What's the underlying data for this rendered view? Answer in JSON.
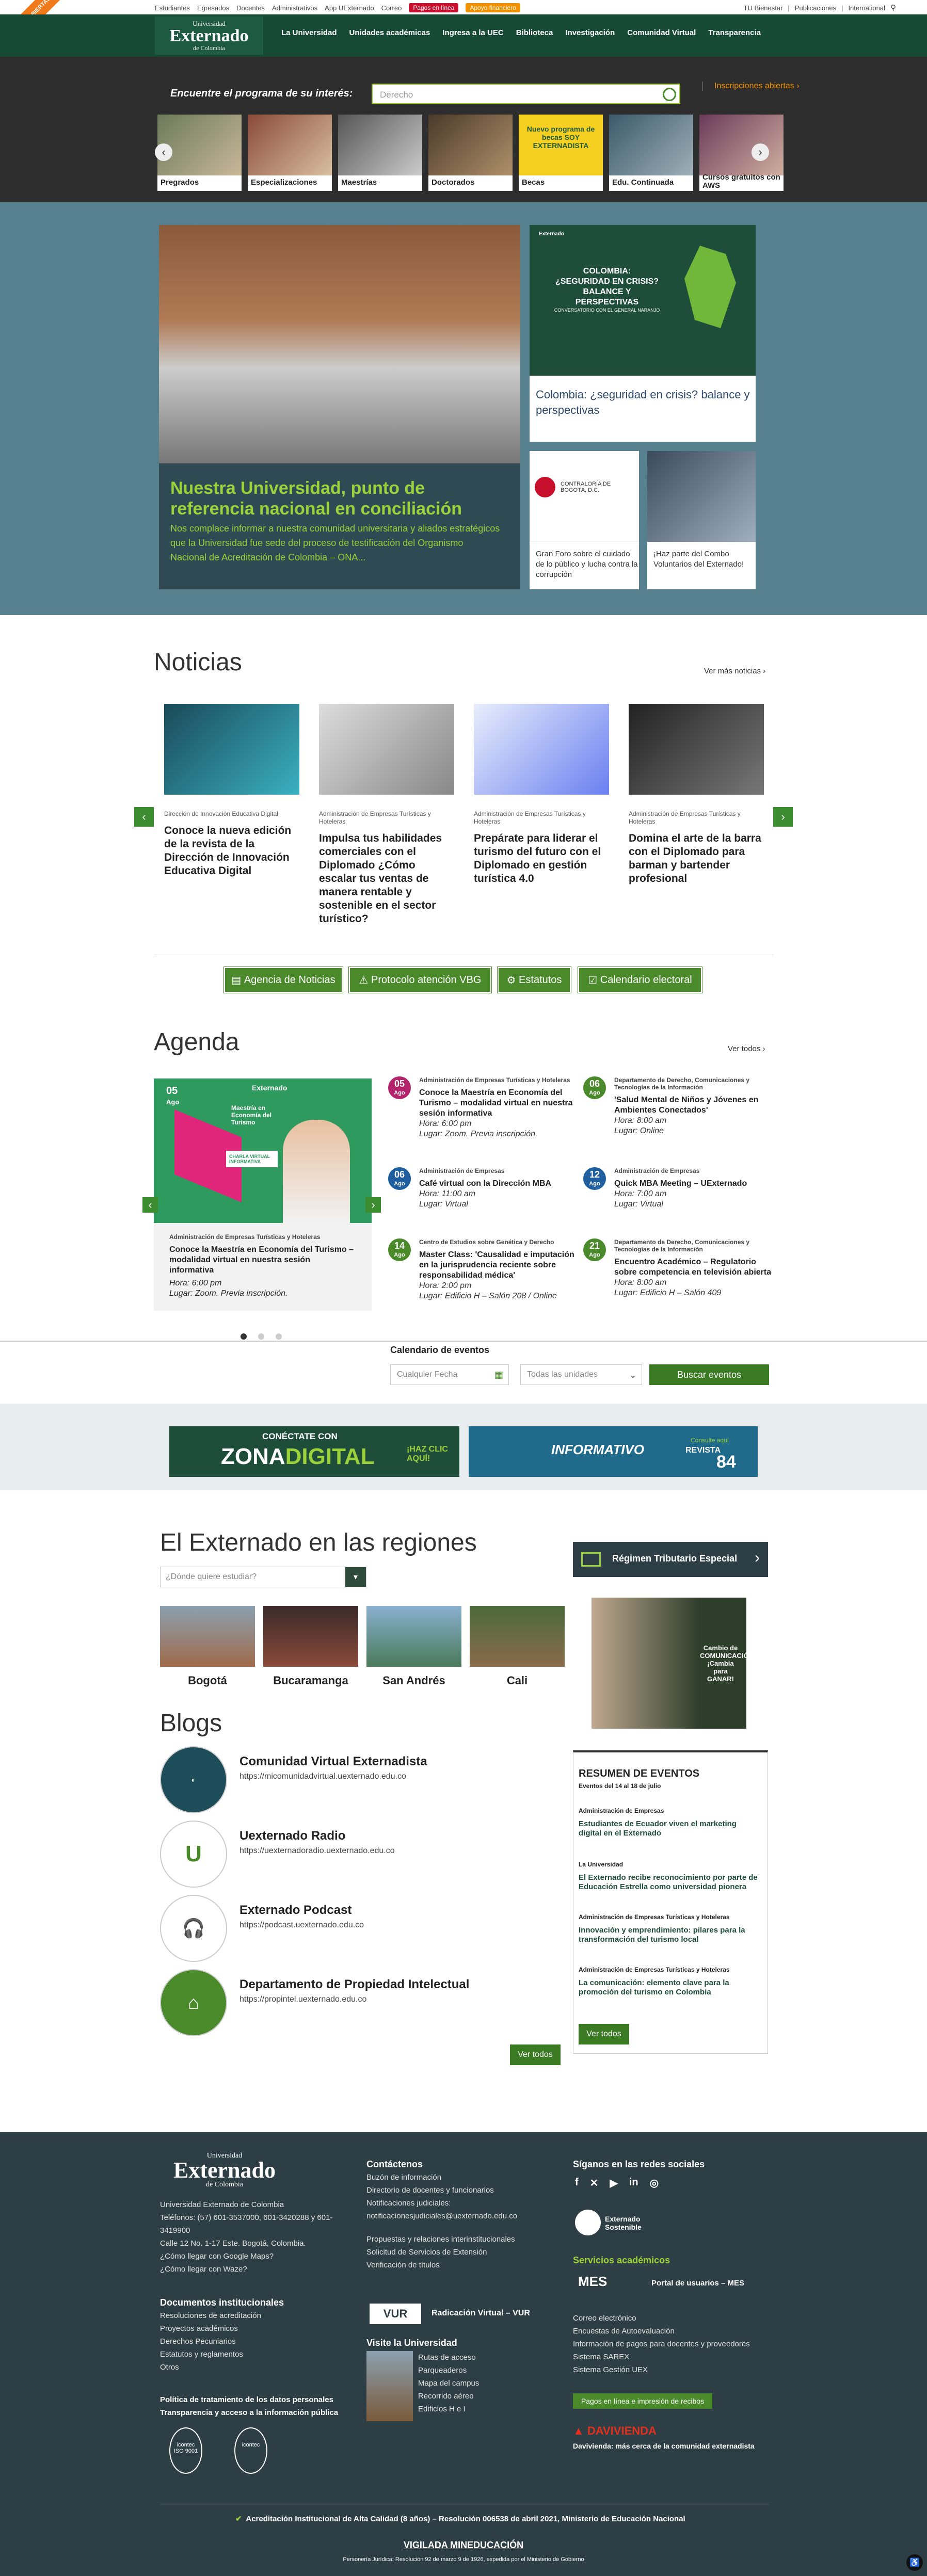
{
  "topbar": {
    "links": [
      "Estudiantes",
      "Egresados",
      "Docentes",
      "Administrativos",
      "App UExternado",
      "Correo"
    ],
    "pay": "Pagos en línea",
    "aid": "Apoyo financiero",
    "right": [
      "TU Bienestar",
      "Publicaciones",
      "International"
    ],
    "ribbon": "INSCRIPCIONES ABIERTAS"
  },
  "logo": {
    "top": "Universidad",
    "main": "Externado",
    "bottom": "de Colombia"
  },
  "menu": [
    "La Universidad",
    "Unidades académicas",
    "Ingresa a la UEC",
    "Biblioteca",
    "Investigación",
    "Comunidad Virtual",
    "Transparencia"
  ],
  "finder": {
    "title": "Encuentre el programa de su interés:",
    "placeholder": "Derecho",
    "inscr": "Inscripciones abiertas",
    "cards": [
      "Pregrados",
      "Especializaciones",
      "Maestrías",
      "Doctorados",
      "Becas",
      "Edu. Continuada",
      "Cursos gratuitos con AWS"
    ],
    "becas_img": "Nuevo programa de becas SOY EXTERNADISTA"
  },
  "hero": {
    "title": "Nuestra Universidad, punto de referencia nacional en conciliación",
    "text": "Nos complace informar a nuestra comunidad universitaria y aliados estratégicos que la Universidad fue sede del proceso de testificación del Organismo Nacional de Acreditación de Colombia – ONA...",
    "side1": "Colombia: ¿seguridad en crisis? balance y perspectivas",
    "side1_img": "COLOMBIA: ¿SEGURIDAD EN CRISIS? BALANCE Y PERSPECTIVAS",
    "side1_sub": "CONVERSATORIO CON EL GENERAL NARANJO",
    "side2": "Gran Foro sobre el cuidado de lo público y lucha contra la corrupción",
    "side2_img": "CONTRALORÍA DE BOGOTÁ, D.C.",
    "side3": "¡Haz parte del Combo Voluntarios del Externado!"
  },
  "news": {
    "title": "Noticias",
    "more": "Ver más noticias",
    "items": [
      {
        "cat": "Dirección de Innovación Educativa Digital",
        "title": "Conoce la nueva edición de la revista de la Dirección de Innovación Educativa Digital"
      },
      {
        "cat": "Administración de Empresas Turísticas y Hoteleras",
        "title": "Impulsa tus habilidades comerciales con el Diplomado ¿Cómo escalar tus ventas de manera rentable y sostenible en el sector turístico?"
      },
      {
        "cat": "Administración de Empresas Turísticas y Hoteleras",
        "title": "Prepárate para liderar el turismo del futuro con el Diplomado en gestión turística 4.0"
      },
      {
        "cat": "Administración de Empresas Turísticas y Hoteleras",
        "title": "Domina el arte de la barra con el Diplomado para barman y bartender profesional"
      }
    ],
    "buttons": [
      "Agencia de Noticias",
      "Protocolo atención VBG",
      "Estatutos",
      "Calendario electoral"
    ]
  },
  "agenda": {
    "title": "Agenda",
    "more": "Ver todos",
    "featured": {
      "day": "05",
      "month": "Ago",
      "cat": "Administración de Empresas Turísticas y Hoteleras",
      "title": "Conoce la Maestría en Economía del Turismo – modalidad virtual en nuestra sesión informativa",
      "hora": "Hora: 6:00 pm",
      "lugar": "Lugar: Zoom. Previa inscripción.",
      "img_title": "Maestría en Economía del Turismo",
      "img_badge": "CHARLA VIRTUAL INFORMATIVA"
    },
    "events": [
      {
        "day": "05",
        "month": "Ago",
        "color": "#b3246c",
        "cat": "Administración de Empresas Turísticas y Hoteleras",
        "title": "Conoce la Maestría en Economía del Turismo – modalidad virtual en nuestra sesión informativa",
        "hora": "Hora: 6:00 pm",
        "lugar": "Lugar: Zoom. Previa inscripción."
      },
      {
        "day": "06",
        "month": "Ago",
        "color": "#4a8a2a",
        "cat": "Departamento de Derecho, Comunicaciones y Tecnologías de la Información",
        "title": "'Salud Mental de Niños y Jóvenes en Ambientes Conectados'",
        "hora": "Hora: 8:00 am",
        "lugar": "Lugar: Online"
      },
      {
        "day": "06",
        "month": "Ago",
        "color": "#1f5fa0",
        "cat": "Administración de Empresas",
        "title": "Café virtual con la Dirección MBA",
        "hora": "Hora: 11:00 am",
        "lugar": "Lugar: Virtual"
      },
      {
        "day": "12",
        "month": "Ago",
        "color": "#1f5fa0",
        "cat": "Administración de Empresas",
        "title": "Quick MBA Meeting – UExternado",
        "hora": "Hora: 7:00 am",
        "lugar": "Lugar: Virtual"
      },
      {
        "day": "14",
        "month": "Ago",
        "color": "#4a8a2a",
        "cat": "Centro de Estudios sobre Genética y Derecho",
        "title": "Master Class: 'Causalidad e imputación en la jurisprudencia reciente sobre responsabilidad médica'",
        "hora": "Hora: 2:00 pm",
        "lugar": "Lugar: Edificio H – Salón 208 / Online"
      },
      {
        "day": "21",
        "month": "Ago",
        "color": "#4a8a2a",
        "cat": "Departamento de Derecho, Comunicaciones y Tecnologías de la Información",
        "title": "Encuentro Académico – Regulatorio sobre competencia en televisión abierta",
        "hora": "Hora: 8:00 am",
        "lugar": "Lugar: Edificio H – Salón 409"
      }
    ]
  },
  "calendar": {
    "title": "Calendario de eventos",
    "date_placeholder": "Cualquier Fecha",
    "units": "Todas las unidades",
    "button": "Buscar eventos"
  },
  "banners": {
    "b1a": "CONÉCTATE CON",
    "b1b": "ZONA",
    "b1c": "DIGITAL",
    "b1d": "¡HAZ CLIC AQUÍ!",
    "b2a": "INFORMATIVO",
    "b2b": "Consulte aquí",
    "b2c": "REVISTA",
    "b2d": "84"
  },
  "regions": {
    "title": "El Externado en las regiones",
    "placeholder": "¿Dónde quiere estudiar?",
    "items": [
      "Bogotá",
      "Bucaramanga",
      "San Andrés",
      "Cali"
    ],
    "regimen": "Régimen Tributario Especial",
    "side_img": "Cambio de COMUNICACIÓN ¡Cambia para GANAR!"
  },
  "blogs": {
    "title": "Blogs",
    "items": [
      {
        "name": "Comunidad Virtual Externadista",
        "url": "https://micomunidadvirtual.uexternado.edu.co"
      },
      {
        "name": "Uexternado Radio",
        "url": "https://uexternadoradio.uexternado.edu.co"
      },
      {
        "name": "Externado Podcast",
        "url": "https://podcast.uexternado.edu.co"
      },
      {
        "name": "Departamento de Propiedad Intelectual",
        "url": "https://propintel.uexternado.edu.co"
      }
    ],
    "more": "Ver todos"
  },
  "summary": {
    "title": "RESUMEN DE EVENTOS",
    "sub": "Eventos del 14 al 18 de julio",
    "items": [
      {
        "cat": "Administración de Empresas",
        "title": "Estudiantes de Ecuador viven el marketing digital en el Externado"
      },
      {
        "cat": "La Universidad",
        "title": "El Externado recibe reconocimiento por parte de Educación Estrella como universidad pionera"
      },
      {
        "cat": "Administración de Empresas Turísticas y Hoteleras",
        "title": "Innovación y emprendimiento: pilares para la transformación del turismo local"
      },
      {
        "cat": "Administración de Empresas Turísticas y Hoteleras",
        "title": "La comunicación: elemento clave para la promoción del turismo en Colombia"
      }
    ],
    "more": "Ver todos"
  },
  "footer": {
    "info": [
      "Universidad Externado de Colombia",
      "Teléfonos: (57) 601-3537000, 601-3420288 y 601-3419900",
      "Calle 12 No. 1-17 Este. Bogotá, Colombia.",
      "¿Cómo llegar con Google Maps?",
      "¿Cómo llegar con Waze?"
    ],
    "docs_title": "Documentos institucionales",
    "docs": [
      "Resoluciones de acreditación",
      "Proyectos académicos",
      "Derechos Pecuniarios",
      "Estatutos y reglamentos",
      "Otros"
    ],
    "policy1": "Política de tratamiento de los datos personales",
    "policy2": "Transparencia y acceso a la información pública",
    "contact_title": "Contáctenos",
    "contact": [
      "Buzón de información",
      "Directorio de docentes y funcionarios",
      "Notificaciones judiciales:",
      "notificacionesjudiciales@uexternado.edu.co"
    ],
    "contact2": [
      "Propuestas y relaciones interinstitucionales",
      "Solicitud de Servicios de Extensión",
      "Verificación de títulos"
    ],
    "vur": "Radicación Virtual – VUR",
    "visit_title": "Visite la Universidad",
    "visit": [
      "Rutas de acceso",
      "Parqueaderos",
      "Mapa del campus",
      "Recorrido aéreo",
      "Edificios H e I"
    ],
    "social_title": "Síganos en las redes sociales",
    "sostenible": "Externado Sostenible",
    "services_title": "Servicios académicos",
    "mes": "Portal de usuarios – MES",
    "services": [
      "Correo electrónico",
      "Encuestas de Autoevaluación",
      "Información de pagos para docentes y proveedores",
      "Sistema SAREX",
      "Sistema Gestión UEX"
    ],
    "pay": "Pagos en línea e impresión de recibos",
    "davi": "Davivienda: más cerca de la comunidad externadista",
    "accred": "Acreditación Institucional de Alta Calidad (8 años) – Resolución 006538 de abril 2021, Ministerio de Educación Nacional",
    "vigilada": "VIGILADA MINEDUCACIÓN",
    "legal": "Personería Jurídica: Resolución 92 de marzo 9 de 1926, expedida por el Ministerio de Gobierno",
    "iso": "ISO 9001",
    "icontec1": "icontec",
    "icontec2": "icontec"
  }
}
